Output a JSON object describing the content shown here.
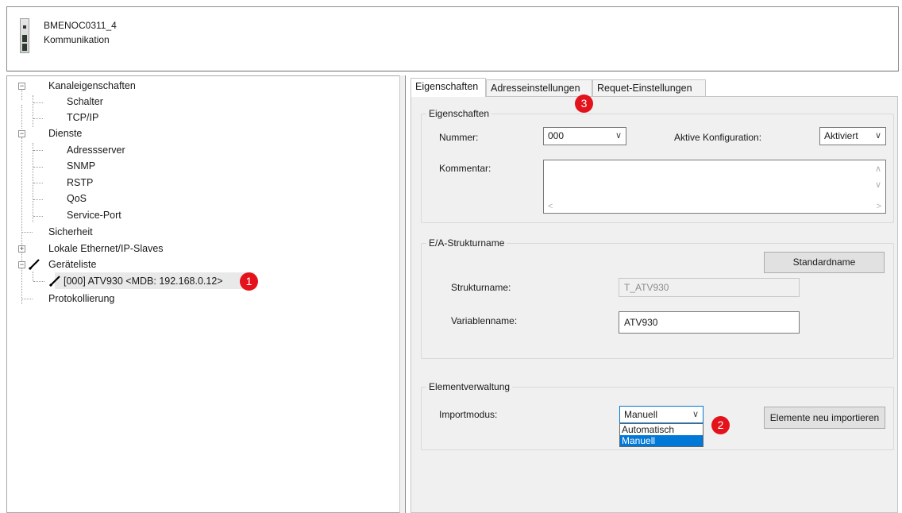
{
  "header": {
    "device_name": "BMENOC0311_4",
    "subtitle": "Kommunikation"
  },
  "tree": {
    "channel_properties": "Kanaleigenschaften",
    "switch": "Schalter",
    "tcpip": "TCP/IP",
    "services": "Dienste",
    "address_server": "Adressserver",
    "snmp": "SNMP",
    "rstp": "RSTP",
    "qos": "QoS",
    "service_port": "Service-Port",
    "security": "Sicherheit",
    "local_slaves": "Lokale Ethernet/IP-Slaves",
    "device_list": "Geräteliste",
    "device_item": "[000] ATV930 <MDB: 192.168.0.12>",
    "logging": "Protokollierung"
  },
  "badges": {
    "one": "1",
    "two": "2",
    "three": "3"
  },
  "tabs": [
    {
      "label": "Eigenschaften",
      "active": true
    },
    {
      "label": "Adresseinstellungen",
      "active": false
    },
    {
      "label": "Requet-Einstellungen",
      "active": false
    }
  ],
  "properties_group": {
    "title": "Eigenschaften",
    "number_label": "Nummer:",
    "number_value": "000",
    "active_config_label": "Aktive Konfiguration:",
    "active_config_value": "Aktiviert",
    "comment_label": "Kommentar:"
  },
  "io_group": {
    "title": "E/A-Strukturname",
    "default_name_button": "Standardname",
    "structure_label": "Strukturname:",
    "structure_value": "T_ATV930",
    "variable_label": "Variablenname:",
    "variable_value": "ATV930"
  },
  "element_group": {
    "title": "Elementverwaltung",
    "import_label": "Importmodus:",
    "import_value": "Manuell",
    "import_options": [
      "Automatisch",
      "Manuell"
    ],
    "reimport_button": "Elemente neu importieren"
  },
  "colors": {
    "badge": "#e3121b",
    "selection": "#0078d7",
    "panel_bg": "#f0f0f0"
  }
}
